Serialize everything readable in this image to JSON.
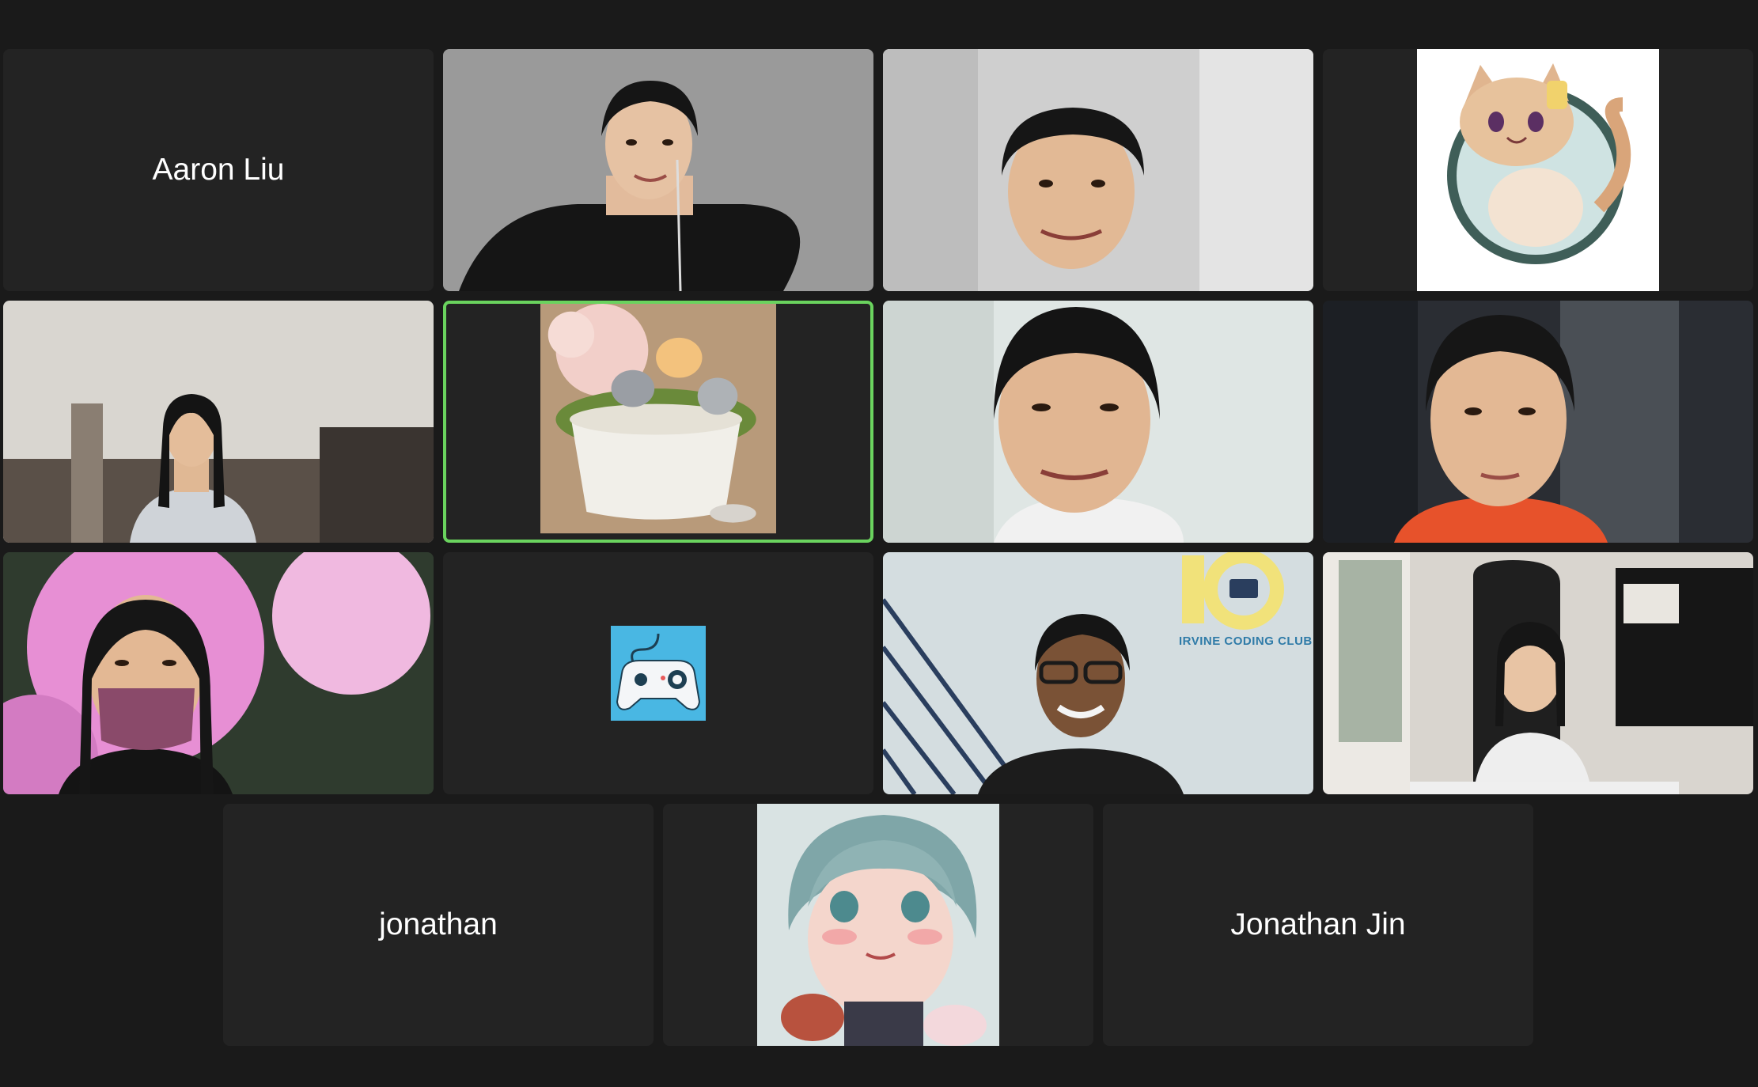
{
  "participants": [
    {
      "name": "Aaron Liu"
    },
    {
      "name": "jonathan"
    },
    {
      "name": "Jonathan Jin"
    }
  ],
  "banner": {
    "logo_text": "IRVINE CODING CLUB"
  },
  "colors": {
    "background": "#1a1a1a",
    "tile": "#232323",
    "active_speaker": "#6ad35e"
  }
}
